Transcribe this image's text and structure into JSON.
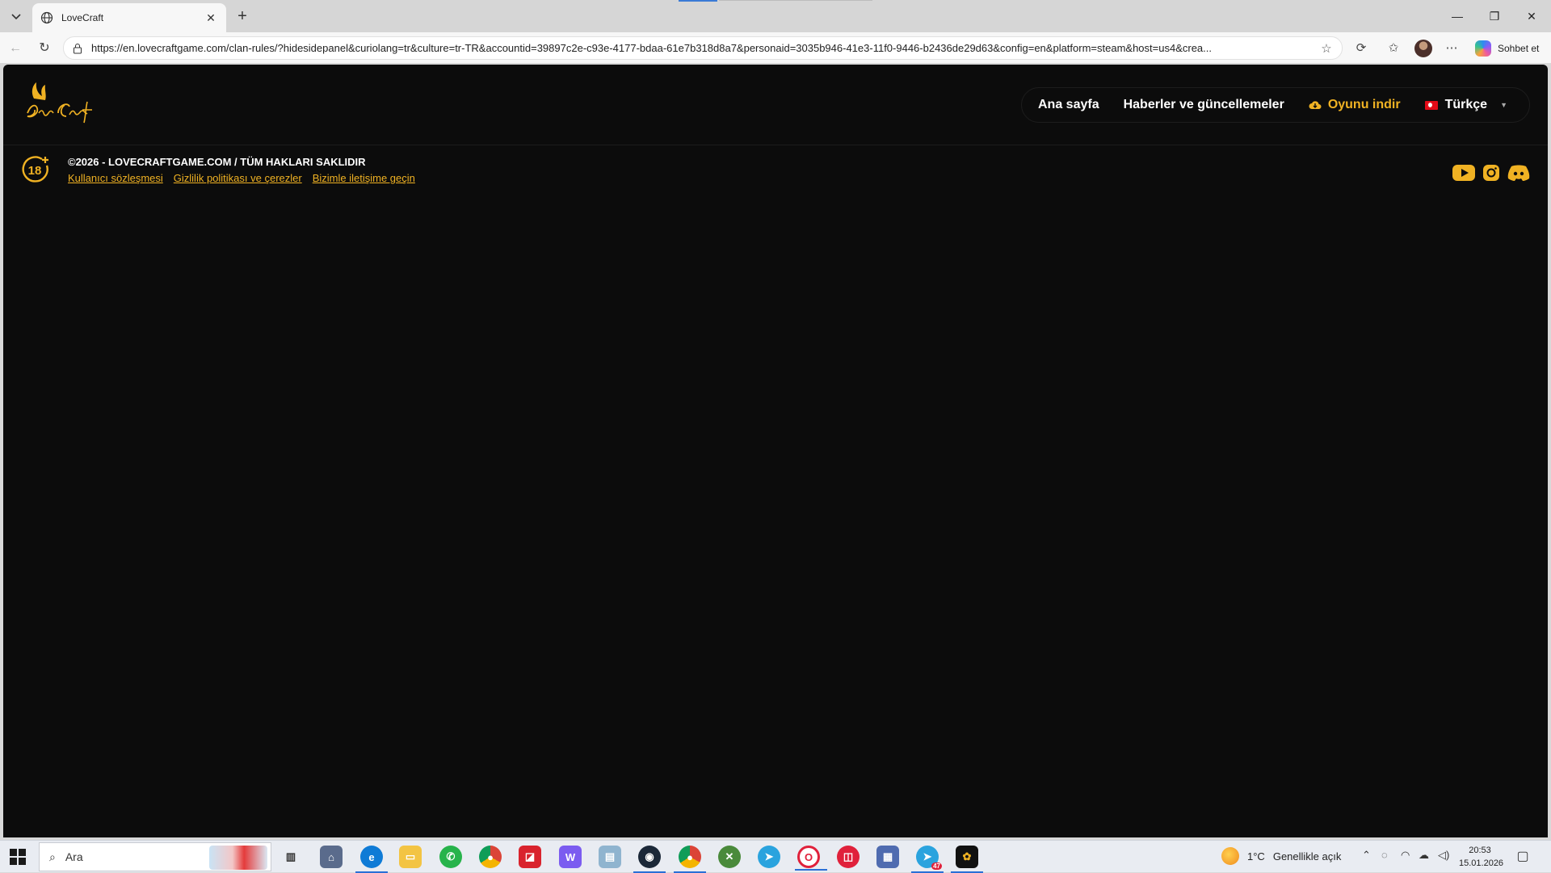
{
  "browser": {
    "tab_title": "LoveCraft",
    "url": "https://en.lovecraftgame.com/clan-rules/?hidesidepanel&curiolang=tr&culture=tr-TR&accountid=39897c2e-c93e-4177-bdaa-61e7b318d8a7&personaid=3035b946-41e3-11f0-9446-b2436de29d63&config=en&platform=steam&host=us4&crea...",
    "chat_label": "Sohbet et"
  },
  "site": {
    "nav": {
      "home": "Ana sayfa",
      "news": "Haberler ve güncellemeler",
      "download": "Oyunu indir",
      "language": "Türkçe"
    },
    "footer": {
      "copyright": "©2026 - LOVECRAFTGAME.COM / TÜM HAKLARI SAKLIDIR",
      "links": [
        "Kullanıcı sözleşmesi",
        "Gizlilik politikası ve çerezler",
        "Bizimle iletişime geçin"
      ]
    },
    "brand_color": "#f0b223",
    "background_color": "#0c0c0c"
  },
  "taskbar": {
    "search_placeholder": "Ara",
    "weather_temp": "1°C",
    "weather_desc": "Genellikle açık",
    "time": "20:53",
    "date": "15.01.2026",
    "telegram_badge": "47"
  },
  "icons": [
    "globe-icon",
    "lock-icon",
    "star-icon",
    "youtube-icon",
    "instagram-icon",
    "discord-icon",
    "cloud-download-icon",
    "age-18-icon"
  ]
}
